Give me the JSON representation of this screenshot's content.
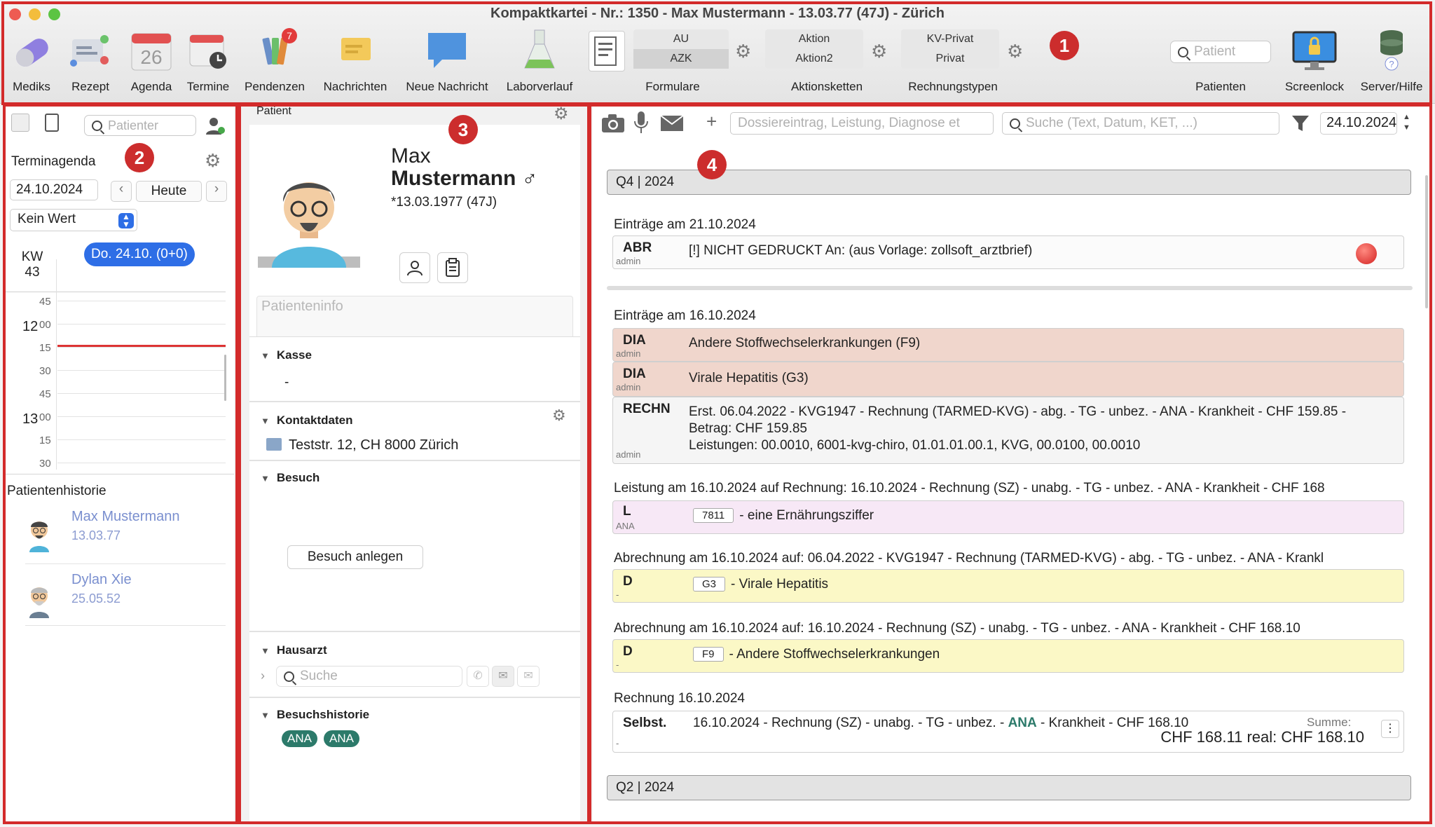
{
  "window": {
    "title": "Kompaktkartei - Nr.: 1350 - Max Mustermann - 13.03.77 (47J) - Zürich"
  },
  "toolbar": {
    "items": [
      {
        "label": "Mediks",
        "icon": "pills-icon"
      },
      {
        "label": "Rezept",
        "icon": "prescription-icon"
      },
      {
        "label": "Agenda",
        "icon": "calendar-icon",
        "day": "26"
      },
      {
        "label": "Termine",
        "icon": "calendar-clock-icon"
      },
      {
        "label": "Pendenzen",
        "icon": "tasks-icon",
        "badge": "7"
      },
      {
        "label": "Nachrichten",
        "icon": "messages-icon"
      },
      {
        "label": "Neue Nachricht",
        "icon": "new-message-icon"
      },
      {
        "label": "Laborverlauf",
        "icon": "flask-icon"
      }
    ],
    "formulare": {
      "label": "Formulare",
      "opt1": "AU",
      "opt2": "AZK"
    },
    "aktionsketten": {
      "label": "Aktionsketten",
      "opt1": "Aktion",
      "opt2": "Aktion2"
    },
    "rechnungstypen": {
      "label": "Rechnungstypen",
      "opt1": "KV-Privat",
      "opt2": "Privat"
    },
    "patient_search": {
      "placeholder": "Patient",
      "label": "Patienten"
    },
    "screenlock": "Screenlock",
    "server": "Server/Hilfe"
  },
  "markers": [
    "1",
    "2",
    "3",
    "4"
  ],
  "agenda": {
    "search_placeholder": "Patienter",
    "title": "Terminagenda",
    "date": "24.10.2024",
    "today": "Heute",
    "filter": "Kein Wert",
    "kw_label": "KW",
    "kw_value": "43",
    "day_pill": "Do. 24.10. (0+0)",
    "times": [
      {
        "hour": "",
        "min": "45"
      },
      {
        "hour": "12",
        "min": "00"
      },
      {
        "hour": "",
        "min": "15"
      },
      {
        "hour": "",
        "min": "30"
      },
      {
        "hour": "",
        "min": "45"
      },
      {
        "hour": "13",
        "min": "00"
      },
      {
        "hour": "",
        "min": "15"
      },
      {
        "hour": "",
        "min": "30"
      }
    ],
    "history_title": "Patientenhistorie",
    "history": [
      {
        "name": "Max Mustermann",
        "date": "13.03.77"
      },
      {
        "name": "Dylan Xie",
        "date": "25.05.52"
      }
    ]
  },
  "patient": {
    "header": "Patient",
    "first_name": "Max",
    "last_name": "Mustermann ♂",
    "dob": "*13.03.1977 (47J)",
    "info_placeholder": "Patienteninfo",
    "kasse_title": "Kasse",
    "kasse_value": "-",
    "kontakt_title": "Kontaktdaten",
    "address": "Teststr. 12, CH 8000 Zürich",
    "besuch_title": "Besuch",
    "besuch_button": "Besuch anlegen",
    "hausarzt_title": "Hausarzt",
    "hausarzt_placeholder": "Suche",
    "besuchshistorie_title": "Besuchshistorie",
    "tags": [
      "ANA",
      "ANA"
    ]
  },
  "dossier": {
    "entry_placeholder": "Dossiereintrag, Leistung, Diagnose et",
    "search_placeholder": "Suche (Text, Datum, KET, ...)",
    "date": "24.10.2024",
    "q4": "Q4 | 2024",
    "q2": "Q2 | 2024",
    "day1": "Einträge am 21.10.2024",
    "abr": {
      "kind": "ABR",
      "user": "admin",
      "text": "[!] NICHT GEDRUCKT An:   (aus Vorlage: zollsoft_arztbrief)"
    },
    "day2": "Einträge am 16.10.2024",
    "dia1": {
      "kind": "DIA",
      "user": "admin",
      "text": "Andere Stoffwechselerkrankungen (F9)"
    },
    "dia2": {
      "kind": "DIA",
      "user": "admin",
      "text": "Virale Hepatitis (G3)"
    },
    "rechn": {
      "kind": "RECHN",
      "user": "admin",
      "line1": "Erst. 06.04.2022 - KVG1947 - Rechnung (TARMED-KVG) - abg. - TG - unbez. - ANA - Krankheit - CHF 159.85 -",
      "line2": "Betrag: CHF 159.85",
      "line3": "Leistungen: 00.0010, 6001-kvg-chiro, 01.01.01.00.1, KVG, 00.0100, 00.0010"
    },
    "leistung_head": "Leistung am 16.10.2024 auf Rechnung: 16.10.2024 - Rechnung (SZ) - unabg. - TG - unbez. - ANA - Krankheit - CHF 168",
    "leistung": {
      "kind": "L",
      "user": "ANA",
      "code": "7811",
      "text": "- eine Ernährungsziffer"
    },
    "abr1_head": "Abrechnung am 16.10.2024 auf: 06.04.2022 - KVG1947 - Rechnung (TARMED-KVG) - abg. - TG - unbez. - ANA - Krankl",
    "abr1": {
      "kind": "D",
      "user": "-",
      "code": "G3",
      "text": "- Virale Hepatitis"
    },
    "abr2_head": "Abrechnung am 16.10.2024 auf: 16.10.2024 - Rechnung (SZ) - unabg. - TG - unbez. - ANA - Krankheit - CHF 168.10",
    "abr2": {
      "kind": "D",
      "user": "-",
      "code": "F9",
      "text": "- Andere Stoffwechselerkrankungen"
    },
    "rechnung_head": "Rechnung 16.10.2024",
    "rechnung": {
      "kind": "Selbst.",
      "user": "-",
      "text_a": "16.10.2024 - Rechnung (SZ) - unabg. - TG - unbez. - ",
      "ana": "ANA",
      "text_b": " - Krankheit - CHF 168.10",
      "sum_label": "Summe:",
      "sum_value": "CHF 168.11 real: CHF 168.10"
    }
  },
  "colors": {
    "accent": "#2e6ee6",
    "marker": "#cc2d2d",
    "diagnosis_bg": "#f0d6cc",
    "leistung_bg": "#f7e8f6",
    "abrechnung_bg": "#fbf8c6",
    "tag": "#2c7a6a"
  }
}
